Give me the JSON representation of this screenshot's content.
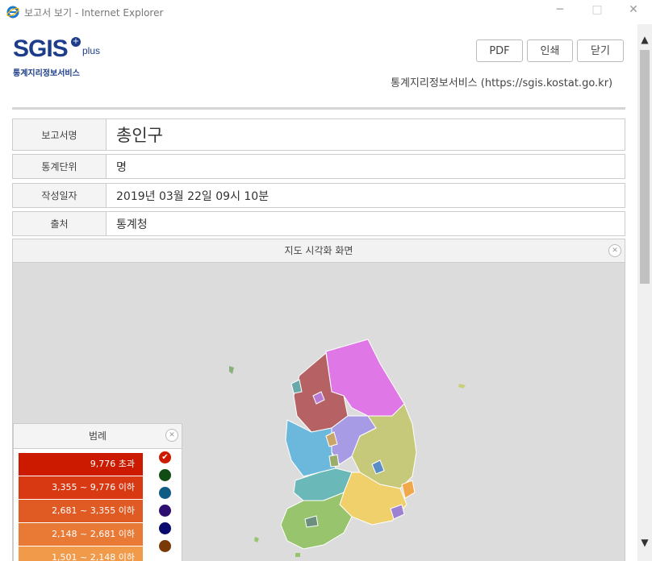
{
  "window": {
    "title": "보고서 보기 - Internet Explorer",
    "minimize": "─",
    "maximize": "□",
    "close": "✕"
  },
  "logo": {
    "text": "SGIS",
    "plus": "plus",
    "subtitle": "통계지리정보서비스"
  },
  "toolbar": {
    "pdf": "PDF",
    "print": "인쇄",
    "close": "닫기"
  },
  "site_text": "통계지리정보서비스 (https://sgis.kostat.go.kr)",
  "info": {
    "report_name_label": "보고서명",
    "report_name": "총인구",
    "unit_label": "통계단위",
    "unit": "명",
    "date_label": "작성일자",
    "date": "2019년 03월 22일 09시 10분",
    "source_label": "출처",
    "source": "통계청"
  },
  "map": {
    "title": "지도 시각화 화면"
  },
  "legend": {
    "title": "범례",
    "items": [
      {
        "label": "9,776 초과",
        "color": "#cc1a00"
      },
      {
        "label": "3,355 ~ 9,776 이하",
        "color": "#d83812"
      },
      {
        "label": "2,681 ~ 3,355 이하",
        "color": "#e05a24"
      },
      {
        "label": "2,148 ~ 2,681 이하",
        "color": "#e87a36"
      },
      {
        "label": "1,501 ~ 2,148 이하",
        "color": "#f09a4a"
      }
    ],
    "palette": [
      "#cc1a00",
      "#114d12",
      "#0e5b85",
      "#2e0e6e",
      "#0a0a6e",
      "#7a3a08"
    ]
  }
}
